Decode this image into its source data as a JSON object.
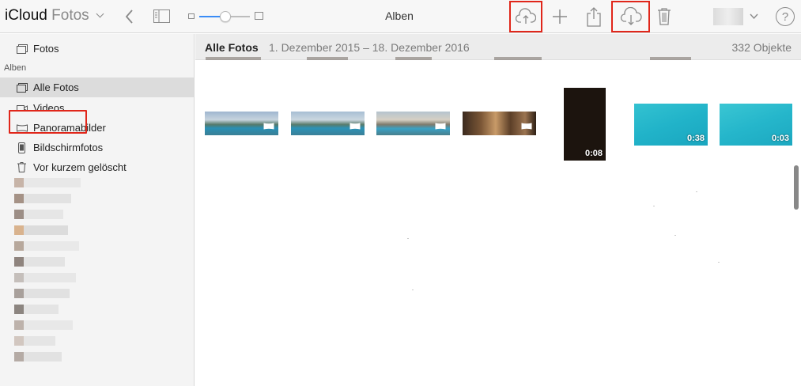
{
  "toolbar": {
    "brand_name": "iCloud",
    "app_name": "Fotos",
    "title": "Alben",
    "icons": {
      "back": "chevron-left-icon",
      "sidebar_toggle": "sidebar-icon",
      "upload": "cloud-upload-icon",
      "add": "plus-icon",
      "share": "share-icon",
      "download": "cloud-download-icon",
      "delete": "trash-icon",
      "account_menu": "chevron-down-icon",
      "help": "help-icon"
    },
    "help_label": "?"
  },
  "zoom": {
    "level": 0.5
  },
  "sidebar": {
    "top_item": {
      "label": "Fotos",
      "icon": "photos-icon"
    },
    "section_label": "Alben",
    "items": [
      {
        "label": "Alle Fotos",
        "icon": "album-icon",
        "active": true
      },
      {
        "label": "Videos",
        "icon": "video-icon",
        "active": false
      },
      {
        "label": "Panoramabilder",
        "icon": "panorama-icon",
        "active": false
      },
      {
        "label": "Bildschirmfotos",
        "icon": "screenshot-icon",
        "active": false
      },
      {
        "label": "Vor kurzem gelöscht",
        "icon": "trash-icon",
        "active": false
      }
    ]
  },
  "main": {
    "header_title": "Alle Fotos",
    "date_range": "1. Dezember 2015 – 18. Dezember 2016",
    "count": "332 Objekte",
    "items": [
      {
        "type": "panorama"
      },
      {
        "type": "panorama"
      },
      {
        "type": "panorama"
      },
      {
        "type": "panorama"
      },
      {
        "type": "video",
        "duration": "0:08"
      },
      {
        "type": "video",
        "duration": "0:38"
      },
      {
        "type": "video",
        "duration": "0:03"
      }
    ]
  },
  "colors": {
    "highlight": "#e0261a",
    "slider_accent": "#3a8cf6",
    "sidebar_active": "#dcdcdc"
  }
}
